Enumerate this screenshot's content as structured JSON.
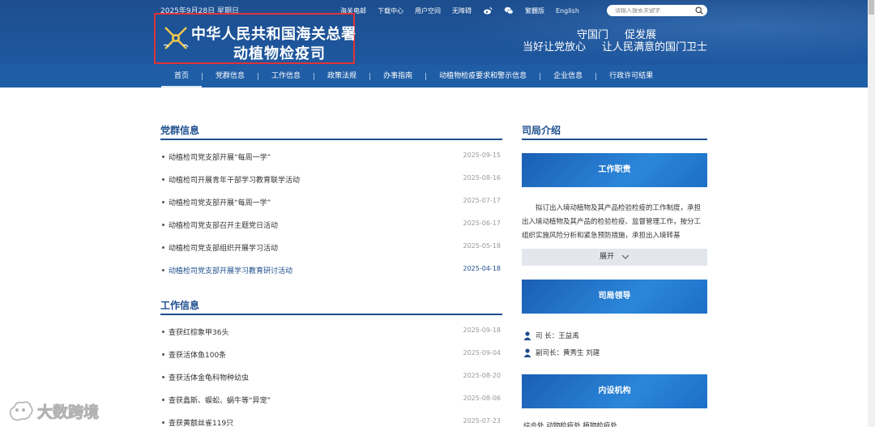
{
  "header": {
    "date": "2025年9月28日 星期日",
    "top_links": [
      "海关电邮",
      "下载中心",
      "用户空间",
      "无障碍",
      "繁體版",
      "English"
    ],
    "search_placeholder": "请输入搜索关键字",
    "logo_line1": "中华人民共和国海关总署",
    "logo_line2": "动植物检疫司",
    "slogan_line1": [
      "守国门",
      "促发展"
    ],
    "slogan_line2": [
      "当好让党放心",
      "让人民满意的国门卫士"
    ],
    "brand_color": "#1d4e8e",
    "highlight_box_color": "#e03236"
  },
  "nav": {
    "items": [
      "首页",
      "党群信息",
      "工作信息",
      "政策法规",
      "办事指南",
      "动植物检疫要求和警示信息",
      "企业信息",
      "行政许可结果"
    ],
    "active": "首页"
  },
  "party_info": {
    "title": "党群信息",
    "items": [
      {
        "title": "动植检司党支部开展“每周一学”",
        "date": "2025-09-15"
      },
      {
        "title": "动植检司开展青年干部学习教育联学活动",
        "date": "2025-08-16"
      },
      {
        "title": "动植检司党支部开展“每周一学”",
        "date": "2025-07-17"
      },
      {
        "title": "动植检司党支部召开主题党日活动",
        "date": "2025-06-17"
      },
      {
        "title": "动植检司党支部组织开展学习活动",
        "date": "2025-05-18"
      },
      {
        "title": "动植检司党支部开展学习教育研讨活动",
        "date": "2025-04-18"
      }
    ]
  },
  "work_info": {
    "title": "工作信息",
    "items": [
      {
        "title": "查获红棕象甲36头",
        "date": "2025-09-18"
      },
      {
        "title": "查获活体鱼100条",
        "date": "2025-09-04"
      },
      {
        "title": "查获活体金龟科物种幼虫",
        "date": "2025-08-20"
      },
      {
        "title": "查获蠡斯、蜈蚣、蜗牛等“异宠”",
        "date": "2025-08-06"
      },
      {
        "title": "查获黄额丝雀119只",
        "date": "2025-07-23"
      }
    ]
  },
  "sidebar": {
    "title": "司局介绍",
    "duty_banner": "工作职责",
    "duty_text": "拟订出入境动植物及其产品检验检疫的工作制度，承担出入境动植物及其产品的检验检疫、监督管理工作，按分工组织实施风险分析和紧急预防措施，承担出入境转基",
    "expand_label": "展开",
    "leaders_banner": "司局领导",
    "leaders": [
      "司  长：王益禹",
      "副司长：黄秀生 刘建"
    ],
    "org_banner": "内设机构",
    "org_partial": "综合处    动物检疫处    植物检疫处"
  },
  "watermark": "大数跨境",
  "icons": [
    "weibo-icon",
    "wechat-icon",
    "search-icon",
    "customs-emblem-icon",
    "person-icon",
    "chevron-down-icon"
  ]
}
